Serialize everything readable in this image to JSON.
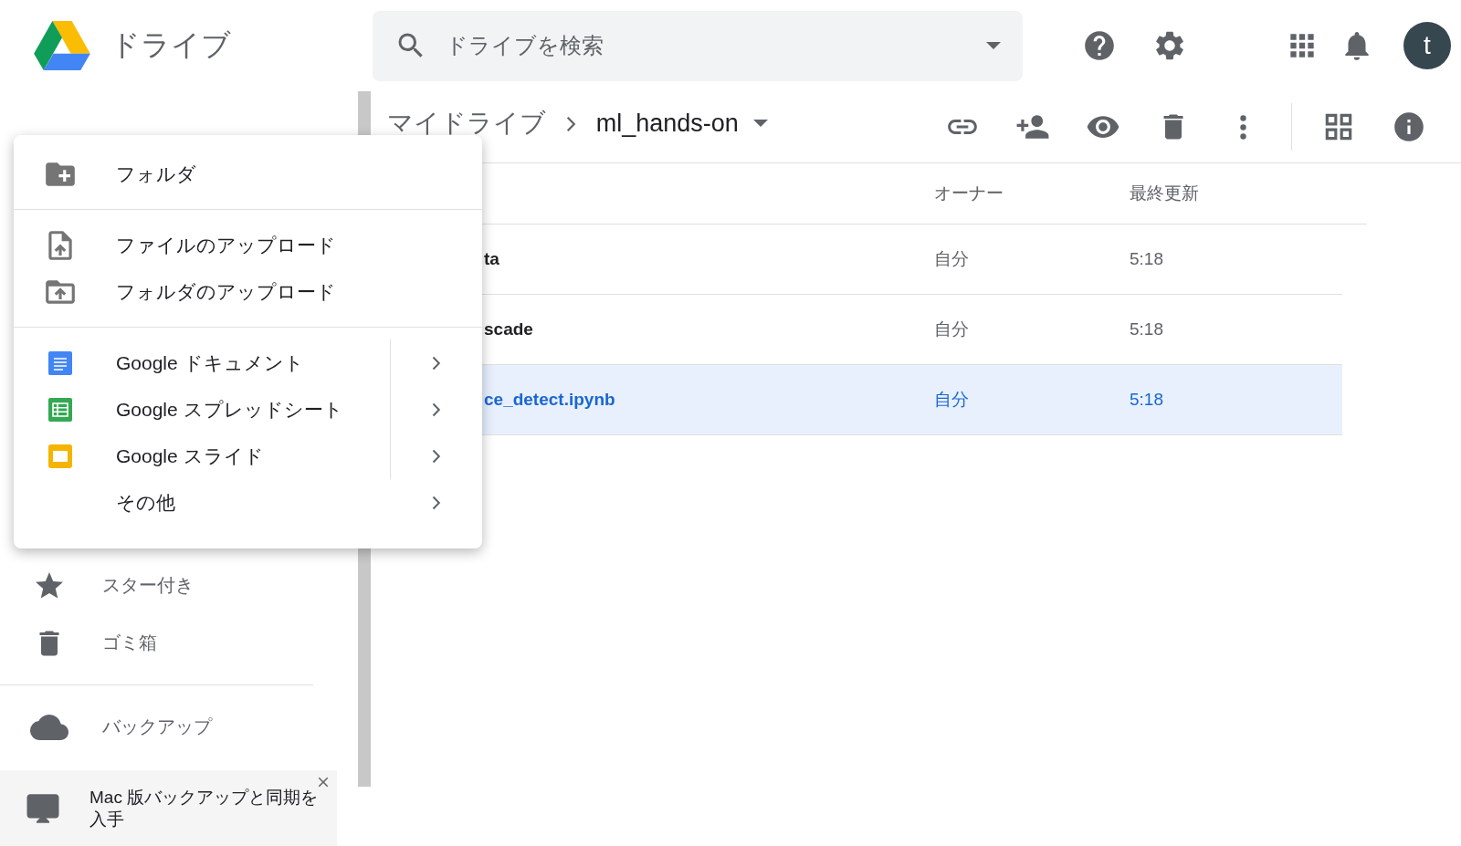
{
  "app": {
    "title": "ドライブ"
  },
  "search": {
    "placeholder": "ドライブを検索"
  },
  "account": {
    "initial": "t"
  },
  "breadcrumb": [
    {
      "label": "マイドライブ"
    },
    {
      "label": "ml_hands-on"
    }
  ],
  "table": {
    "columns": [
      "オーナー",
      "最終更新"
    ],
    "rows": [
      {
        "name": "ta",
        "owner": "自分",
        "modified": "5:18",
        "selected": false
      },
      {
        "name": "scade",
        "owner": "自分",
        "modified": "5:18",
        "selected": false
      },
      {
        "name": "ce_detect.ipynb",
        "owner": "自分",
        "modified": "5:18",
        "selected": true
      }
    ]
  },
  "new_menu": {
    "groups": [
      [
        {
          "kind": "new-folder",
          "label": "フォルダ"
        }
      ],
      [
        {
          "kind": "file-upload",
          "label": "ファイルのアップロード"
        },
        {
          "kind": "folder-upload",
          "label": "フォルダのアップロード"
        }
      ],
      [
        {
          "kind": "docs",
          "label": "Google ドキュメント"
        },
        {
          "kind": "sheets",
          "label": "Google スプレッドシート"
        },
        {
          "kind": "slides",
          "label": "Google スライド"
        },
        {
          "kind": "more",
          "label": "その他"
        }
      ]
    ]
  },
  "sidebar": {
    "items": [
      {
        "kind": "starred",
        "label": "スター付き"
      },
      {
        "kind": "trash",
        "label": "ゴミ箱"
      },
      {
        "kind": "backup",
        "label": "バックアップ"
      }
    ],
    "promo": {
      "text": "Mac 版バックアップと同期を入手"
    }
  }
}
